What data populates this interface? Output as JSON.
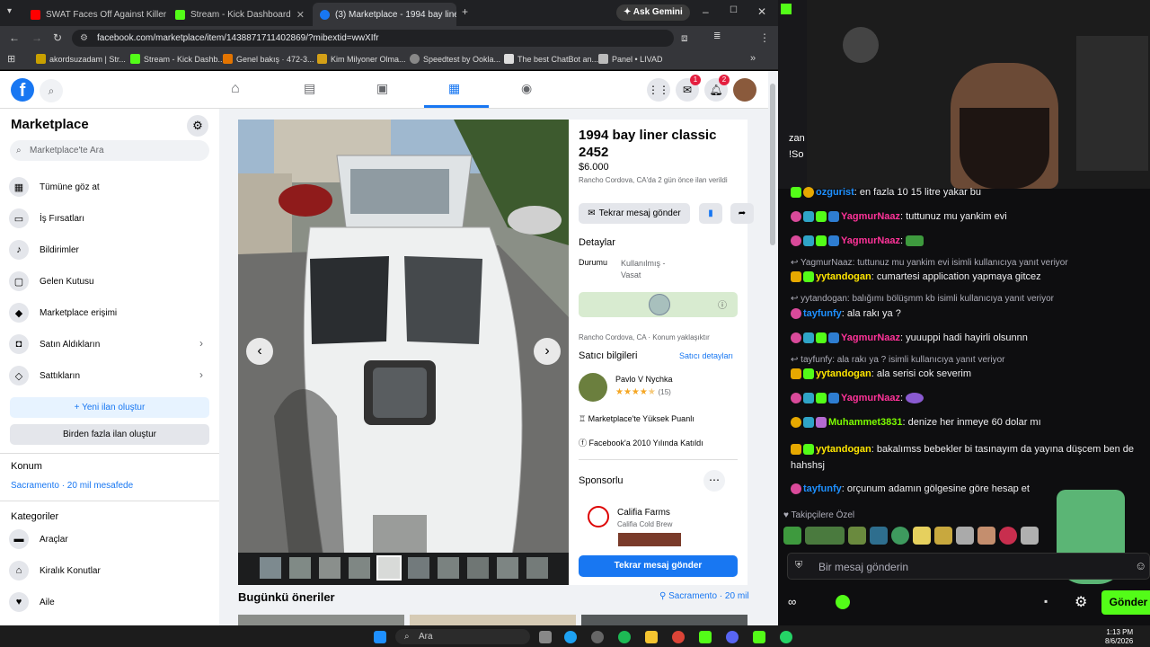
{
  "browser": {
    "tabs": [
      {
        "label": "SWAT Faces Off Against Killer A"
      },
      {
        "label": "Stream - Kick Dashboard"
      },
      {
        "label": "(3) Marketplace - 1994 bay line"
      }
    ],
    "ask_gemini": "Ask Gemini",
    "url": "facebook.com/marketplace/item/1438871711402869/?mibextid=wwXIfr",
    "bookmarks": [
      "akordsuzadam | Str...",
      "Stream - Kick Dashb...",
      "Genel bakış · 472-3...",
      "Kim Milyoner Olma...",
      "Speedtest by Ookla...",
      "The best ChatBot an...",
      "Panel • LIVAD"
    ]
  },
  "fb": {
    "nav_badges": {
      "messenger": "1",
      "notifications": "2"
    },
    "sidebar": {
      "title": "Marketplace",
      "search_placeholder": "Marketplace'te Ara",
      "items": [
        "Tümüne göz at",
        "İş Fırsatları",
        "Bildirimler",
        "Gelen Kutusu",
        "Marketplace erişimi",
        "Satın Aldıkların",
        "Sattıkların"
      ],
      "new_listing": "+ Yeni ilan oluştur",
      "multi_listing": "Birden fazla ilan oluştur",
      "location_header": "Konum",
      "location_value": "Sacramento · 20 mil mesafede",
      "categories_header": "Kategoriler",
      "categories": [
        "Araçlar",
        "Kiralık Konutlar",
        "Aile"
      ]
    },
    "listing": {
      "title": "1994 bay liner classic 2452",
      "price": "$6.000",
      "listed": "Rancho Cordova, CA'da 2 gün önce ilan verildi",
      "send_again": "Tekrar mesaj gönder",
      "details_header": "Detaylar",
      "condition_label": "Durumu",
      "condition_value": "Kullanılmış - Vasat",
      "map_location": "Rancho Cordova, CA",
      "map_note": "Konum yaklaşıktır",
      "seller_header": "Satıcı bilgileri",
      "seller_link": "Satıcı detayları",
      "seller_name": "Pavlo V Nychka",
      "seller_rating": 4.5,
      "seller_count": "(15)",
      "trust1": "Marketplace'te Yüksek Puanlı",
      "trust2": "Facebook'a 2010 Yılında Katıldı",
      "sponsored": "Sponsorlu",
      "ad_name": "Califia Farms",
      "ad_sub": "Califia Cold Brew",
      "send_again_blue": "Tekrar mesaj gönder"
    },
    "suggestions": {
      "title": "Bugünkü öneriler",
      "location": "Sacramento · 20 mil"
    }
  },
  "twitch": {
    "overlay_top": [
      "zan",
      "!So"
    ],
    "chat": [
      {
        "user": "ozgurist",
        "color": "#1e90ff",
        "msg": ": en fazla 10 15 litre yakar bu",
        "kind": "msg"
      },
      {
        "user": "YagmurNaaz",
        "color": "#ff3399",
        "msg": ": tuttunuz mu yankim evi",
        "kind": "msg"
      },
      {
        "user": "YagmurNaaz",
        "color": "#ff3399",
        "msg": ":",
        "kind": "msg"
      },
      {
        "reply": "YagmurNaaz: tuttunuz mu yankim evi isimli kullanıcıya yanıt veriyor",
        "kind": "reply"
      },
      {
        "user": "yytandogan",
        "color": "#ffe600",
        "msg": ": cumartesi application yapmaya gitcez",
        "kind": "msg"
      },
      {
        "reply": "yytandogan: balığımı bölüşmm kb isimli kullanıcıya yanıt veriyor",
        "kind": "reply"
      },
      {
        "user": "tayfunfy",
        "color": "#1e90ff",
        "msg": ": ala rakı ya ?",
        "kind": "msg"
      },
      {
        "user": "YagmurNaaz",
        "color": "#ff3399",
        "msg": ": yuuuppi hadi hayirli olsunnn",
        "kind": "msg"
      },
      {
        "reply": "tayfunfy: ala rakı ya ? isimli kullanıcıya yanıt veriyor",
        "kind": "reply"
      },
      {
        "user": "yytandogan",
        "color": "#ffe600",
        "msg": ": ala serisi cok severim",
        "kind": "msg"
      },
      {
        "user": "YagmurNaaz",
        "color": "#ff3399",
        "msg": ":",
        "kind": "msg"
      },
      {
        "user": "Muhammet3831",
        "color": "#7cfc00",
        "msg": ": denize her inmeye 60 dolar mı",
        "kind": "msg"
      },
      {
        "user": "yytandogan",
        "color": "#ffe600",
        "msg": ": bakalımss bebekler bi tasınayım da yayına düşcem ben de hahshsj",
        "kind": "msg"
      },
      {
        "user": "tayfunfy",
        "color": "#1e90ff",
        "msg": ": orçunum adamın gölgesine göre hesap et",
        "kind": "msg"
      }
    ],
    "emote_label": "Takipçilere Özel",
    "chat_placeholder": "Bir mesaj gönderin",
    "send_label": "Gönder"
  },
  "taskbar": {
    "search": "Ara",
    "time": "1:13 PM",
    "date": "8/6/2026"
  }
}
